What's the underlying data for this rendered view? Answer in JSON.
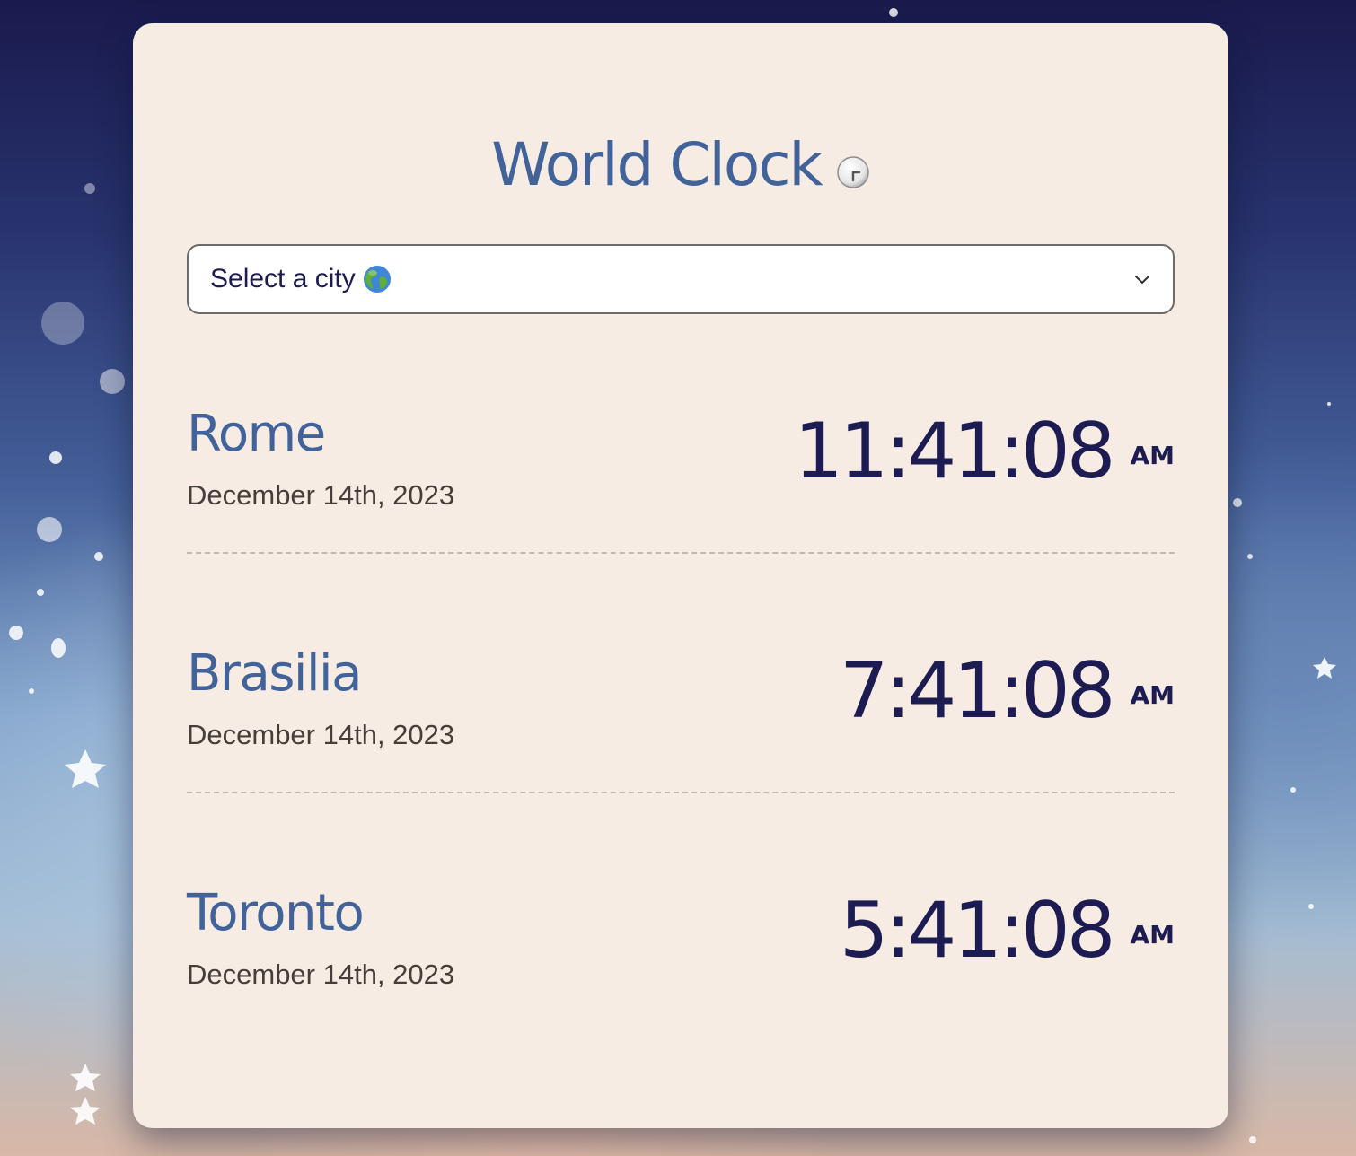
{
  "title": "World Clock",
  "title_icon": "clock-icon",
  "select": {
    "label": "Select a city",
    "icon": "globe-icon"
  },
  "cities": [
    {
      "name": "Rome",
      "date": "December 14th, 2023",
      "time": "11:41:08",
      "ampm": "AM"
    },
    {
      "name": "Brasilia",
      "date": "December 14th, 2023",
      "time": "7:41:08",
      "ampm": "AM"
    },
    {
      "name": "Toronto",
      "date": "December 14th, 2023",
      "time": "5:41:08",
      "ampm": "AM"
    }
  ],
  "colors": {
    "card_background": "#f6ece3",
    "title": "#41639a",
    "time": "#1c1c52",
    "date": "#463e3a",
    "separator": "#c2bab1"
  }
}
